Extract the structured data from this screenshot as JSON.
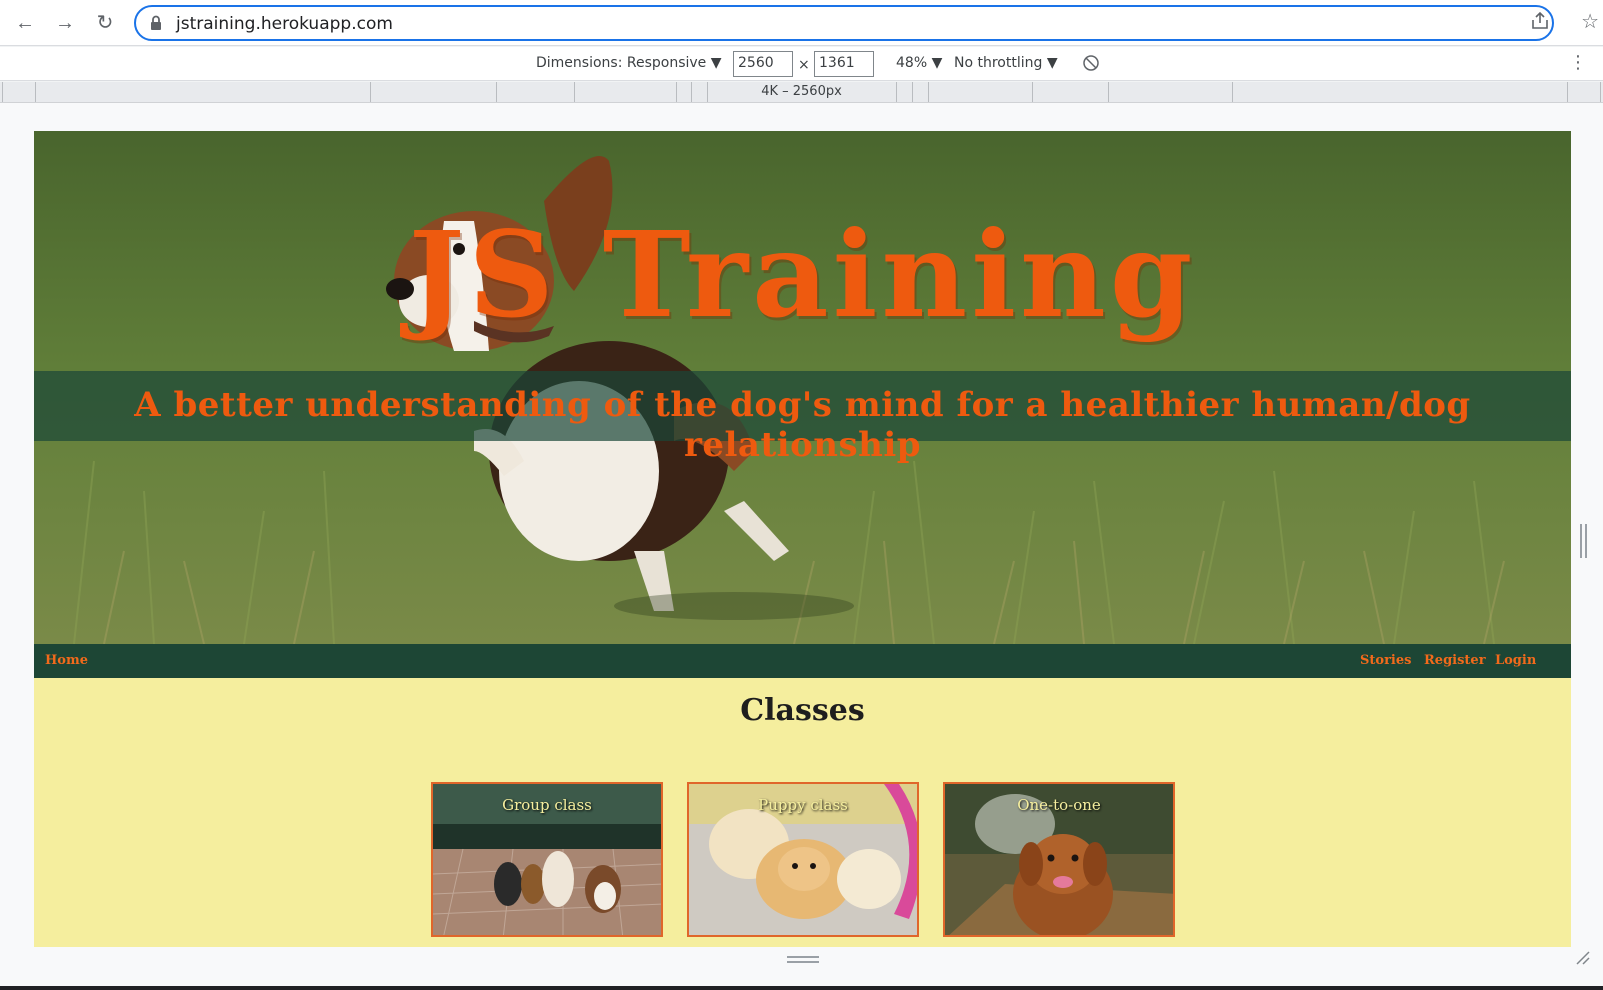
{
  "browser": {
    "url": "jstraining.herokuapp.com",
    "icons": [
      "back-arrow-icon",
      "forward-arrow-icon",
      "reload-icon",
      "lock-icon",
      "share-icon",
      "bookmark-star-icon"
    ]
  },
  "devtools": {
    "dimensions_label": "Dimensions: Responsive ▼",
    "width": "2560",
    "times": "×",
    "height": "1361",
    "zoom": "48% ▼",
    "throttling": "No throttling ▼",
    "breakpoint_label": "4K – 2560px"
  },
  "site": {
    "title": "JS Training",
    "tagline": "A better understanding of the dog's mind for a healthier human/dog relationship",
    "nav": {
      "home": "Home",
      "stories": "Stories",
      "register": "Register",
      "login": "Login"
    },
    "classes": {
      "heading": "Classes",
      "cards": [
        {
          "label": "Group class"
        },
        {
          "label": "Puppy class"
        },
        {
          "label": "One-to-one"
        }
      ]
    }
  },
  "colors": {
    "accent_orange": "#ee5a0f",
    "nav_green": "#1d4635",
    "page_yellow": "#f5ee9e",
    "focus_blue": "#1a73e8"
  }
}
